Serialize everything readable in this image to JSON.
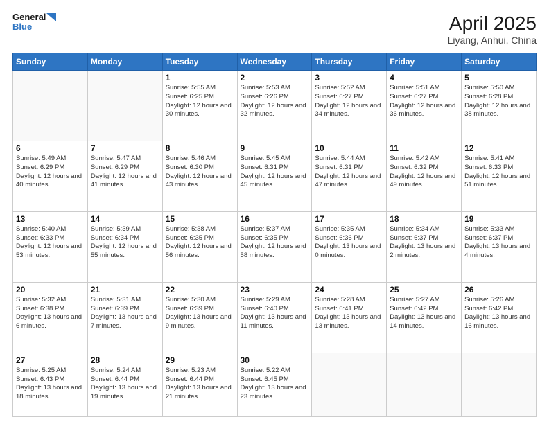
{
  "header": {
    "logo_general": "General",
    "logo_blue": "Blue",
    "title": "April 2025",
    "location": "Liyang, Anhui, China"
  },
  "weekdays": [
    "Sunday",
    "Monday",
    "Tuesday",
    "Wednesday",
    "Thursday",
    "Friday",
    "Saturday"
  ],
  "weeks": [
    [
      {
        "day": "",
        "info": ""
      },
      {
        "day": "",
        "info": ""
      },
      {
        "day": "1",
        "info": "Sunrise: 5:55 AM\nSunset: 6:25 PM\nDaylight: 12 hours and 30 minutes."
      },
      {
        "day": "2",
        "info": "Sunrise: 5:53 AM\nSunset: 6:26 PM\nDaylight: 12 hours and 32 minutes."
      },
      {
        "day": "3",
        "info": "Sunrise: 5:52 AM\nSunset: 6:27 PM\nDaylight: 12 hours and 34 minutes."
      },
      {
        "day": "4",
        "info": "Sunrise: 5:51 AM\nSunset: 6:27 PM\nDaylight: 12 hours and 36 minutes."
      },
      {
        "day": "5",
        "info": "Sunrise: 5:50 AM\nSunset: 6:28 PM\nDaylight: 12 hours and 38 minutes."
      }
    ],
    [
      {
        "day": "6",
        "info": "Sunrise: 5:49 AM\nSunset: 6:29 PM\nDaylight: 12 hours and 40 minutes."
      },
      {
        "day": "7",
        "info": "Sunrise: 5:47 AM\nSunset: 6:29 PM\nDaylight: 12 hours and 41 minutes."
      },
      {
        "day": "8",
        "info": "Sunrise: 5:46 AM\nSunset: 6:30 PM\nDaylight: 12 hours and 43 minutes."
      },
      {
        "day": "9",
        "info": "Sunrise: 5:45 AM\nSunset: 6:31 PM\nDaylight: 12 hours and 45 minutes."
      },
      {
        "day": "10",
        "info": "Sunrise: 5:44 AM\nSunset: 6:31 PM\nDaylight: 12 hours and 47 minutes."
      },
      {
        "day": "11",
        "info": "Sunrise: 5:42 AM\nSunset: 6:32 PM\nDaylight: 12 hours and 49 minutes."
      },
      {
        "day": "12",
        "info": "Sunrise: 5:41 AM\nSunset: 6:33 PM\nDaylight: 12 hours and 51 minutes."
      }
    ],
    [
      {
        "day": "13",
        "info": "Sunrise: 5:40 AM\nSunset: 6:33 PM\nDaylight: 12 hours and 53 minutes."
      },
      {
        "day": "14",
        "info": "Sunrise: 5:39 AM\nSunset: 6:34 PM\nDaylight: 12 hours and 55 minutes."
      },
      {
        "day": "15",
        "info": "Sunrise: 5:38 AM\nSunset: 6:35 PM\nDaylight: 12 hours and 56 minutes."
      },
      {
        "day": "16",
        "info": "Sunrise: 5:37 AM\nSunset: 6:35 PM\nDaylight: 12 hours and 58 minutes."
      },
      {
        "day": "17",
        "info": "Sunrise: 5:35 AM\nSunset: 6:36 PM\nDaylight: 13 hours and 0 minutes."
      },
      {
        "day": "18",
        "info": "Sunrise: 5:34 AM\nSunset: 6:37 PM\nDaylight: 13 hours and 2 minutes."
      },
      {
        "day": "19",
        "info": "Sunrise: 5:33 AM\nSunset: 6:37 PM\nDaylight: 13 hours and 4 minutes."
      }
    ],
    [
      {
        "day": "20",
        "info": "Sunrise: 5:32 AM\nSunset: 6:38 PM\nDaylight: 13 hours and 6 minutes."
      },
      {
        "day": "21",
        "info": "Sunrise: 5:31 AM\nSunset: 6:39 PM\nDaylight: 13 hours and 7 minutes."
      },
      {
        "day": "22",
        "info": "Sunrise: 5:30 AM\nSunset: 6:39 PM\nDaylight: 13 hours and 9 minutes."
      },
      {
        "day": "23",
        "info": "Sunrise: 5:29 AM\nSunset: 6:40 PM\nDaylight: 13 hours and 11 minutes."
      },
      {
        "day": "24",
        "info": "Sunrise: 5:28 AM\nSunset: 6:41 PM\nDaylight: 13 hours and 13 minutes."
      },
      {
        "day": "25",
        "info": "Sunrise: 5:27 AM\nSunset: 6:42 PM\nDaylight: 13 hours and 14 minutes."
      },
      {
        "day": "26",
        "info": "Sunrise: 5:26 AM\nSunset: 6:42 PM\nDaylight: 13 hours and 16 minutes."
      }
    ],
    [
      {
        "day": "27",
        "info": "Sunrise: 5:25 AM\nSunset: 6:43 PM\nDaylight: 13 hours and 18 minutes."
      },
      {
        "day": "28",
        "info": "Sunrise: 5:24 AM\nSunset: 6:44 PM\nDaylight: 13 hours and 19 minutes."
      },
      {
        "day": "29",
        "info": "Sunrise: 5:23 AM\nSunset: 6:44 PM\nDaylight: 13 hours and 21 minutes."
      },
      {
        "day": "30",
        "info": "Sunrise: 5:22 AM\nSunset: 6:45 PM\nDaylight: 13 hours and 23 minutes."
      },
      {
        "day": "",
        "info": ""
      },
      {
        "day": "",
        "info": ""
      },
      {
        "day": "",
        "info": ""
      }
    ]
  ]
}
